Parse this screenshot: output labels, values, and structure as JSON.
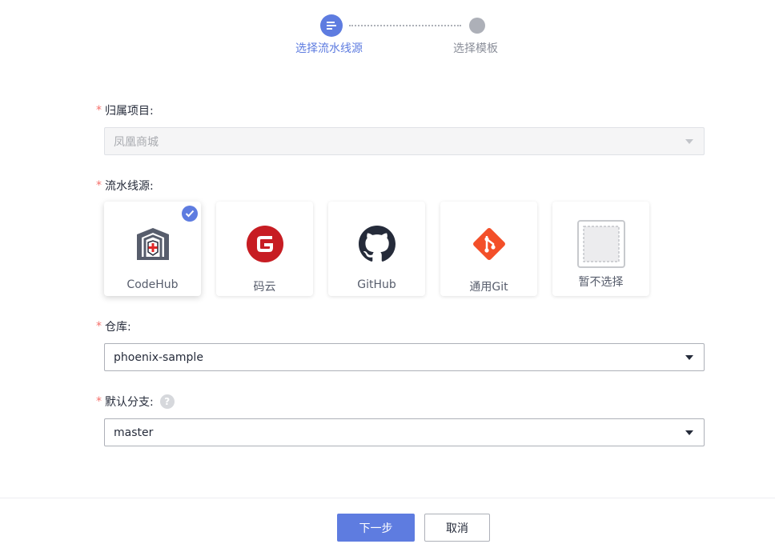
{
  "steps": [
    {
      "label": "选择流水线源",
      "state": "active",
      "icon": "list-icon"
    },
    {
      "label": "选择模板",
      "state": "inactive"
    }
  ],
  "form": {
    "project": {
      "label": "归属项目:",
      "value": "凤凰商城",
      "disabled": true
    },
    "source": {
      "label": "流水线源:",
      "selected": "CodeHub",
      "options": [
        {
          "name": "CodeHub",
          "icon": "codehub-icon"
        },
        {
          "name": "码云",
          "icon": "gitee-icon"
        },
        {
          "name": "GitHub",
          "icon": "github-icon"
        },
        {
          "name": "通用Git",
          "icon": "git-icon"
        },
        {
          "name": "暂不选择",
          "icon": "none-icon"
        }
      ]
    },
    "repo": {
      "label": "仓库:",
      "value": "phoenix-sample"
    },
    "branch": {
      "label": "默认分支:",
      "value": "master",
      "help": "?"
    }
  },
  "footer": {
    "next_label": "下一步",
    "cancel_label": "取消"
  },
  "colors": {
    "primary": "#5e7ce0",
    "required": "#f66f6a",
    "gitee": "#c71d23",
    "git": "#f34f29"
  }
}
